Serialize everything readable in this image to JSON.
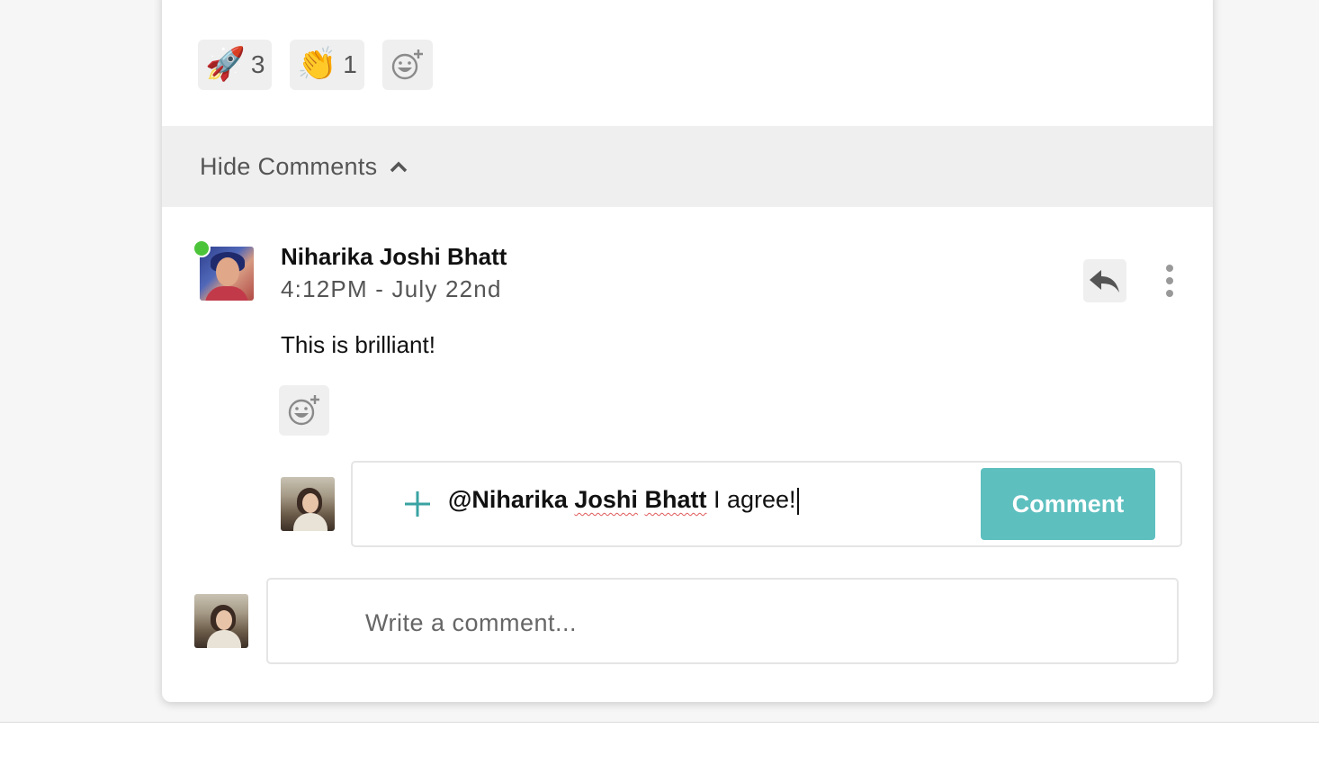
{
  "reactions": [
    {
      "emoji": "🚀",
      "name": "rocket",
      "count": "3"
    },
    {
      "emoji": "👏",
      "name": "clapping-hands",
      "count": "1"
    }
  ],
  "add_reaction_icon": "emoji-add-icon",
  "comments_toggle": {
    "label": "Hide Comments",
    "icon": "chevron-up-icon"
  },
  "comment": {
    "author": "Niharika Joshi Bhatt",
    "timestamp": "4:12PM - July 22nd",
    "text": "This is brilliant!",
    "online": true,
    "online_color": "#4cc43a"
  },
  "reply": {
    "mention_first": "@Niharika",
    "mention_middle": "Joshi",
    "mention_last": "Bhatt",
    "rest": "I agree!",
    "button_label": "Comment",
    "button_color": "#5ebfbf"
  },
  "new_comment": {
    "placeholder": "Write a comment..."
  }
}
